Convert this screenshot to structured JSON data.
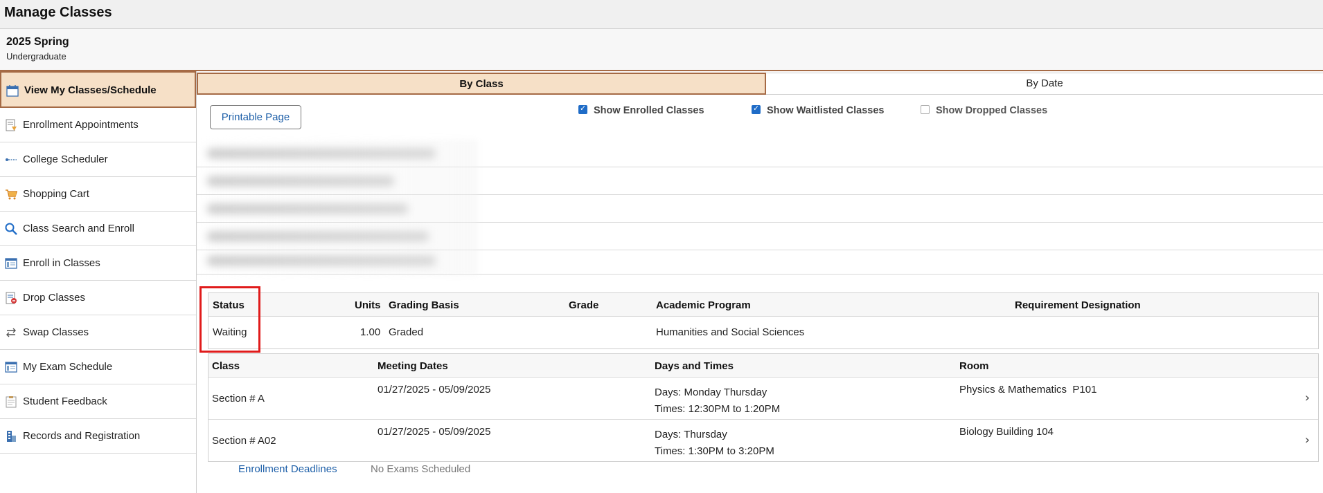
{
  "header": {
    "title": "Manage Classes"
  },
  "term": {
    "name": "2025 Spring",
    "career": "Undergraduate"
  },
  "sidebar": {
    "items": [
      {
        "label": "View My Classes/Schedule",
        "icon": "calendar-icon",
        "active": true
      },
      {
        "label": "Enrollment Appointments",
        "icon": "appointment-icon"
      },
      {
        "label": "College Scheduler",
        "icon": "scheduler-icon"
      },
      {
        "label": "Shopping Cart",
        "icon": "cart-icon"
      },
      {
        "label": "Class Search and Enroll",
        "icon": "search-icon"
      },
      {
        "label": "Enroll in Classes",
        "icon": "enroll-icon"
      },
      {
        "label": "Drop Classes",
        "icon": "drop-icon"
      },
      {
        "label": "Swap Classes",
        "icon": "swap-icon"
      },
      {
        "label": "My Exam Schedule",
        "icon": "exam-icon"
      },
      {
        "label": "Student Feedback",
        "icon": "feedback-icon"
      },
      {
        "label": "Records and Registration",
        "icon": "records-icon"
      }
    ]
  },
  "tabs": {
    "by_class": "By Class",
    "by_date": "By Date"
  },
  "toolbar": {
    "printable": "Printable Page",
    "show_enrolled": "Show Enrolled Classes",
    "show_waitlisted": "Show Waitlisted Classes",
    "show_dropped": "Show Dropped Classes"
  },
  "status_table": {
    "headers": {
      "status": "Status",
      "units": "Units",
      "grading": "Grading Basis",
      "grade": "Grade",
      "program": "Academic Program",
      "requirement": "Requirement Designation"
    },
    "row": {
      "status": "Waiting",
      "units": "1.00",
      "grading": "Graded",
      "grade": "",
      "program": "Humanities and Social Sciences",
      "requirement": ""
    }
  },
  "sections_table": {
    "headers": {
      "class": "Class",
      "dates": "Meeting Dates",
      "days": "Days and Times",
      "room": "Room"
    },
    "rows": [
      {
        "class": "Section # A",
        "dates": "01/27/2025 - 05/09/2025",
        "days": "Days: Monday Thursday",
        "times": "Times: 12:30PM to 1:20PM",
        "room": "Physics & Mathematics  P101"
      },
      {
        "class": "Section # A02",
        "dates": "01/27/2025 - 05/09/2025",
        "days": "Days: Thursday",
        "times": "Times: 1:30PM to 3:20PM",
        "room": "Biology Building 104"
      }
    ]
  },
  "footer": {
    "deadlines": "Enrollment Deadlines",
    "exams": "No Exams Scheduled"
  },
  "colors": {
    "accent": "#a56a45",
    "active_bg": "#f6e0c7",
    "link": "#1d5fa8",
    "highlight": "#e01b1b",
    "checkbox": "#1f6cc7"
  }
}
